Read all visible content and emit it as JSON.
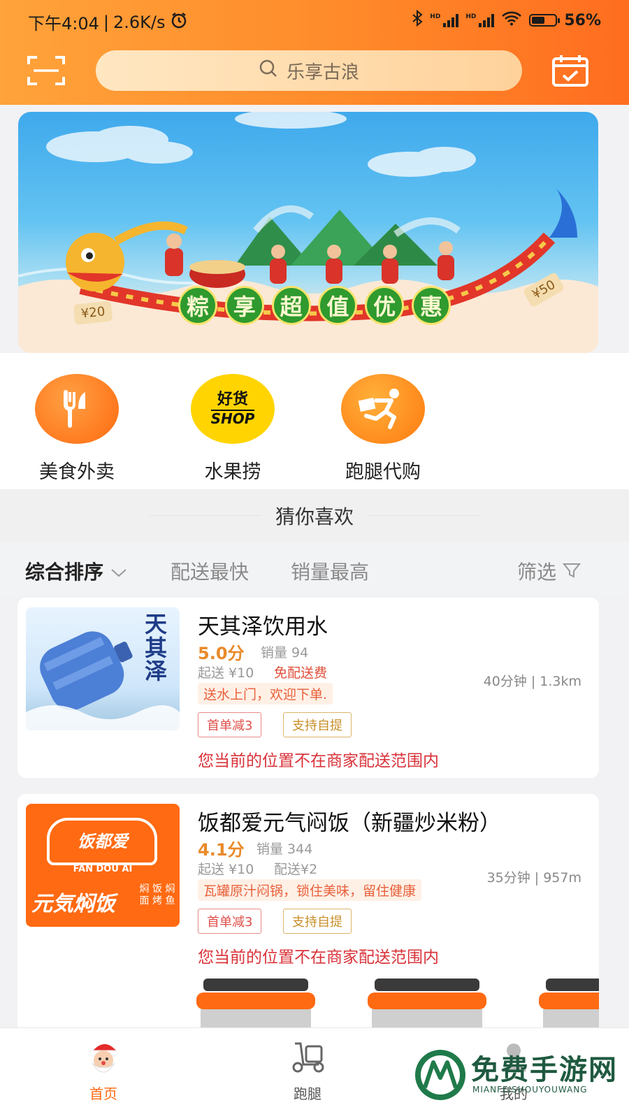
{
  "status_bar": {
    "time": "下午4:04",
    "speed": "2.6K/s",
    "battery": "56%",
    "battery_level": 0.56
  },
  "header": {
    "search_placeholder": "乐享古浪",
    "scan_icon": "scan-icon",
    "calendar_icon": "calendar-check-icon",
    "colors": {
      "gradient_start": "#ffa33a",
      "gradient_end": "#ff6d1f"
    }
  },
  "banner": {
    "headline_chars": [
      "粽",
      "享",
      "超",
      "值",
      "优",
      "惠"
    ],
    "coin_left": "¥20",
    "coin_right": "¥50"
  },
  "quick_entries": [
    {
      "label": "美食外卖",
      "icon": "fork-knife-icon",
      "color": "#ff7a1a"
    },
    {
      "label": "水果捞",
      "icon": "shop-badge-icon",
      "badge_top": "好货",
      "badge_bottom": "SHOP",
      "color": "#ffd400"
    },
    {
      "label": "跑腿代购",
      "icon": "runner-icon",
      "color": "#ff8a12"
    }
  ],
  "section_title": "猜你喜欢",
  "sort_bar": {
    "items": [
      "综合排序",
      "配送最快",
      "销量最高"
    ],
    "filter": "筛选"
  },
  "stores": [
    {
      "name": "天其泽饮用水",
      "rating": "5.0分",
      "sales": "销量 94",
      "min_order": "起送 ¥10",
      "delivery_fee": "免配送费",
      "notice": "送水上门，欢迎下单.",
      "tags": [
        "首单减3",
        "支持自提"
      ],
      "distance": "40分钟 | 1.3km",
      "warning": "您当前的位置不在商家配送范围内",
      "thumb_text": "天其泽"
    },
    {
      "name": "饭都爱元气闷饭（新疆炒米粉）",
      "rating": "4.1分",
      "sales": "销量 344",
      "min_order": "起送 ¥10",
      "delivery_fee": "配送¥2",
      "notice": "瓦罐原汁闷锅，锁住美味，留住健康",
      "tags": [
        "首单减3",
        "支持自提"
      ],
      "distance": "35分钟 | 957m",
      "warning": "您当前的位置不在商家配送范围内",
      "thumb_logo": "饭都爱",
      "thumb_sub": "FAN DOU AI",
      "thumb_bottom": "元気焖饭",
      "thumb_side": "焖 饭 焖 面 烤 鱼"
    }
  ],
  "bottom_nav": [
    {
      "label": "首页",
      "icon": "santa-home-icon",
      "active": true
    },
    {
      "label": "跑腿",
      "icon": "scooter-icon",
      "active": false
    },
    {
      "label": "我的",
      "icon": "user-icon",
      "active": false
    }
  ],
  "watermark": {
    "title": "免费手游网",
    "sub": "MIANFEISHOUYOUWANG"
  }
}
